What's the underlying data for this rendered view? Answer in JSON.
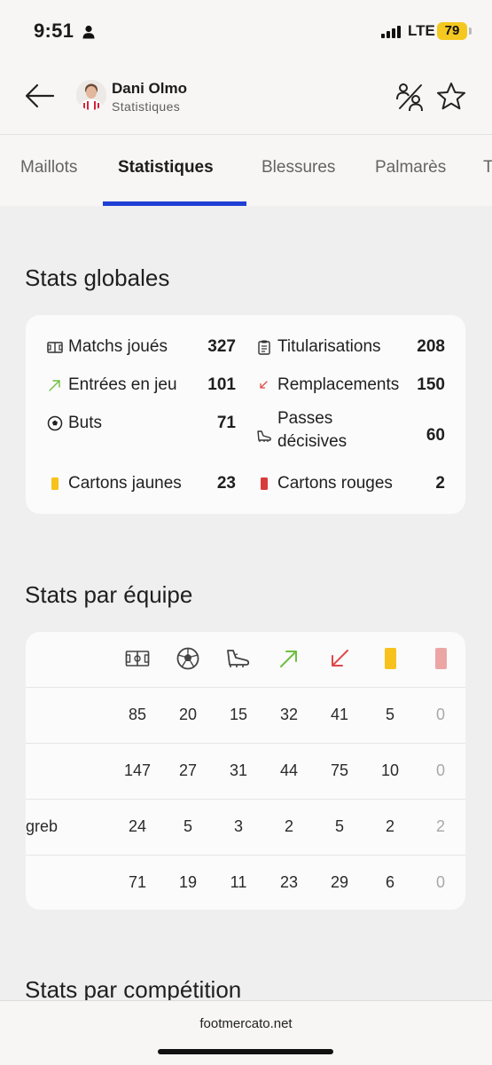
{
  "status": {
    "time": "9:51",
    "network": "LTE",
    "battery": "79"
  },
  "header": {
    "name": "Dani Olmo",
    "subtitle": "Statistiques"
  },
  "tabs": [
    {
      "label": "Maillots"
    },
    {
      "label": "Statistiques",
      "active": true
    },
    {
      "label": "Blessures"
    },
    {
      "label": "Palmarès"
    },
    {
      "label": "T"
    }
  ],
  "global": {
    "title": "Stats globales",
    "items": [
      {
        "icon": "pitch-icon",
        "label": "Matchs joués",
        "value": "327"
      },
      {
        "icon": "clipboard-icon",
        "label": "Titularisations",
        "value": "208"
      },
      {
        "icon": "arrow-in-icon",
        "label": "Entrées en jeu",
        "value": "101"
      },
      {
        "icon": "arrow-out-icon",
        "label": "Remplacements",
        "value": "150"
      },
      {
        "icon": "ball-icon",
        "label": "Buts",
        "value": "71"
      },
      {
        "icon": "boot-icon",
        "label": "Passes décisives",
        "value": "60"
      },
      {
        "icon": "yellow-card-icon",
        "label": "Cartons jaunes",
        "value": "23"
      },
      {
        "icon": "red-card-icon",
        "label": "Cartons rouges",
        "value": "2"
      }
    ]
  },
  "team": {
    "title": "Stats par équipe",
    "columns": [
      "pitch-icon",
      "ball-icon",
      "boot-icon",
      "arrow-in-icon",
      "arrow-out-icon",
      "yellow-card-icon",
      "red-card-icon"
    ],
    "rows": [
      {
        "team": "",
        "values": [
          "85",
          "20",
          "15",
          "32",
          "41",
          "5",
          "0"
        ]
      },
      {
        "team": "",
        "values": [
          "147",
          "27",
          "31",
          "44",
          "75",
          "10",
          "0"
        ]
      },
      {
        "team": "greb",
        "values": [
          "24",
          "5",
          "3",
          "2",
          "5",
          "2",
          "2"
        ]
      },
      {
        "team": "",
        "values": [
          "71",
          "19",
          "11",
          "23",
          "29",
          "6",
          "0"
        ]
      }
    ]
  },
  "competition": {
    "title": "Stats par compétition"
  },
  "footer": {
    "site": "footmercato.net"
  },
  "colors": {
    "accent": "#1e3fd6",
    "yellow_card": "#f7c21c",
    "red_card": "#d93b3b",
    "arrow_in": "#6fbe3f",
    "arrow_out": "#e04848"
  }
}
